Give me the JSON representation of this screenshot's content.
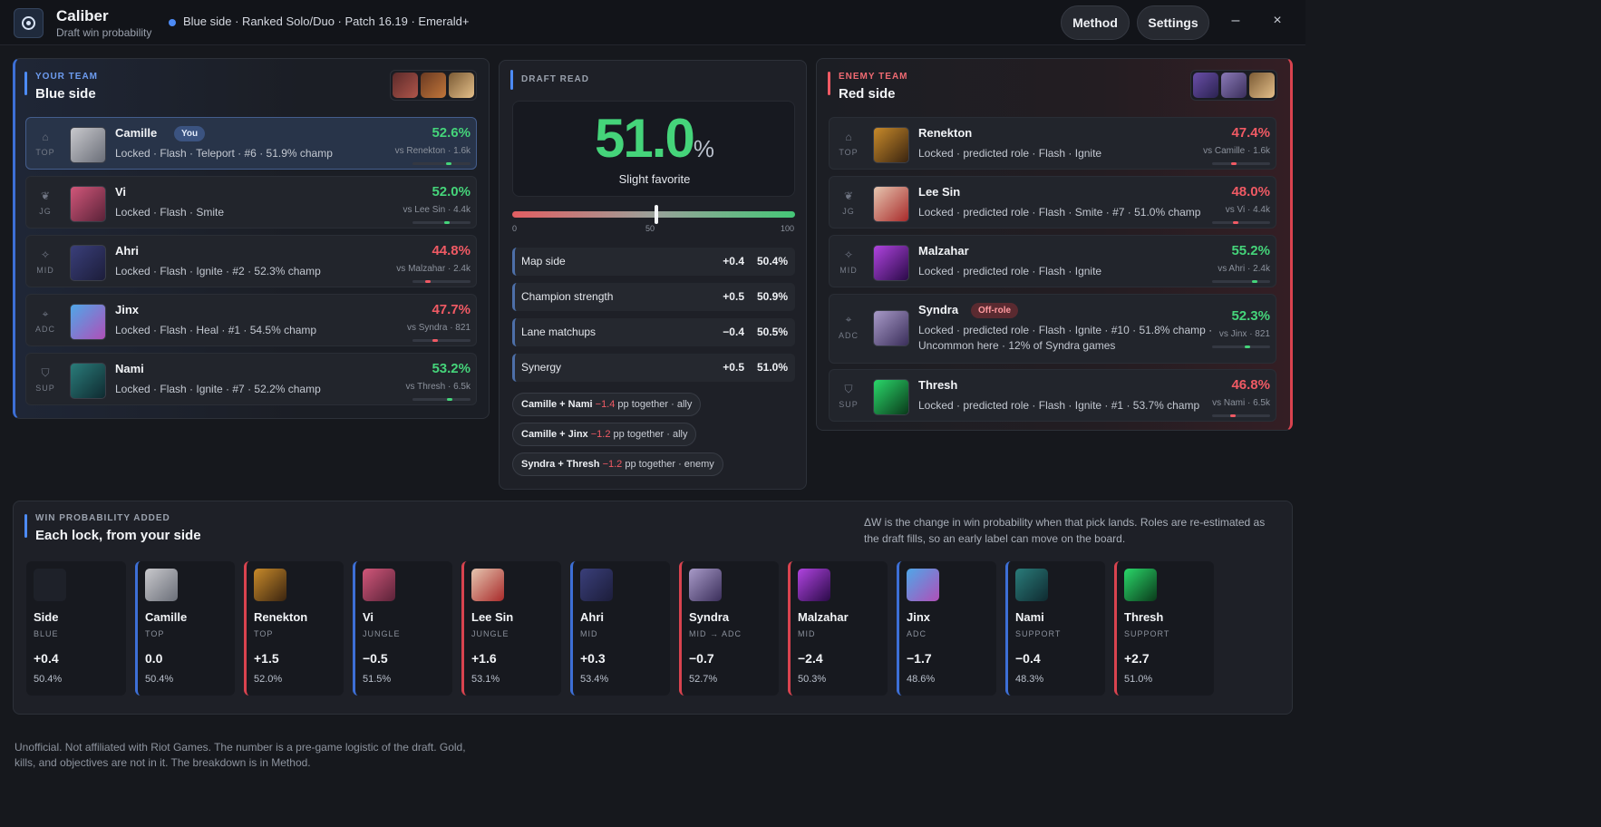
{
  "app": {
    "name": "Caliber",
    "subtitle": "Draft win probability",
    "context": "Blue side · Ranked Solo/Duo · Patch 16.19 · Emerald+",
    "method_label": "Method",
    "settings_label": "Settings",
    "minimize": "–",
    "close": "×"
  },
  "your_team": {
    "kicker": "YOUR TEAM",
    "title": "Blue side",
    "rows": [
      {
        "role": "TOP",
        "role_icon": "tower-icon",
        "name": "Camille",
        "badge": "You",
        "sub": "Locked · Flash · Teleport · #6 · 51.9% champ",
        "pct": "52.6%",
        "vs": "vs Renekton · 1.6k",
        "pct_value": 52.6
      },
      {
        "role": "JG",
        "role_icon": "leaf-icon",
        "name": "Vi",
        "sub": "Locked · Flash · Smite",
        "pct": "52.0%",
        "vs": "vs Lee Sin · 4.4k",
        "pct_value": 52.0
      },
      {
        "role": "MID",
        "role_icon": "star-icon",
        "name": "Ahri",
        "sub": "Locked · Flash · Ignite · #2 · 52.3% champ",
        "pct": "44.8%",
        "vs": "vs Malzahar · 2.4k",
        "pct_value": 44.8
      },
      {
        "role": "ADC",
        "role_icon": "crosshair-icon",
        "name": "Jinx",
        "sub": "Locked · Flash · Heal · #1 · 54.5% champ",
        "pct": "47.7%",
        "vs": "vs Syndra · 821",
        "pct_value": 47.7
      },
      {
        "role": "SUP",
        "role_icon": "shield-icon",
        "name": "Nami",
        "sub": "Locked · Flash · Ignite · #7 · 52.2% champ",
        "pct": "53.2%",
        "vs": "vs Thresh · 6.5k",
        "pct_value": 53.2
      }
    ]
  },
  "draft_read": {
    "kicker": "DRAFT READ",
    "win_number": "51.0",
    "win_unit": "%",
    "win_value": 51.0,
    "verdict": "Slight favorite",
    "scale": [
      "0",
      "50",
      "100"
    ],
    "factors": [
      {
        "label": "Map side",
        "delta": "+0.4",
        "value": "50.4%"
      },
      {
        "label": "Champion strength",
        "delta": "+0.5",
        "value": "50.9%"
      },
      {
        "label": "Lane matchups",
        "delta": "−0.4",
        "value": "50.5%"
      },
      {
        "label": "Synergy",
        "delta": "+0.5",
        "value": "51.0%"
      }
    ],
    "synergies": [
      {
        "pair": "Camille + Nami",
        "delta": "−1.4",
        "text": "pp together · ally"
      },
      {
        "pair": "Camille + Jinx",
        "delta": "−1.2",
        "text": "pp together · ally"
      },
      {
        "pair": "Syndra + Thresh",
        "delta": "−1.2",
        "text": "pp together · enemy"
      }
    ]
  },
  "enemy_team": {
    "kicker": "ENEMY TEAM",
    "title": "Red side",
    "rows": [
      {
        "role": "TOP",
        "role_icon": "tower-icon",
        "name": "Renekton",
        "sub": "Locked · predicted role · Flash · Ignite",
        "pct": "47.4%",
        "vs": "vs Camille · 1.6k",
        "pct_value": 47.4
      },
      {
        "role": "JG",
        "role_icon": "leaf-icon",
        "name": "Lee Sin",
        "sub": "Locked · predicted role · Flash · Smite · #7 · 51.0% champ",
        "pct": "48.0%",
        "vs": "vs Vi · 4.4k",
        "pct_value": 48.0
      },
      {
        "role": "MID",
        "role_icon": "star-icon",
        "name": "Malzahar",
        "sub": "Locked · predicted role · Flash · Ignite",
        "pct": "55.2%",
        "vs": "vs Ahri · 2.4k",
        "pct_value": 55.2
      },
      {
        "role": "ADC",
        "role_icon": "crosshair-icon",
        "name": "Syndra",
        "badge": "Off-role",
        "sub": "Locked · predicted role · Flash · Ignite · #10 · 51.8% champ ·",
        "sub2": "Uncommon here · 12% of Syndra games",
        "pct": "52.3%",
        "vs": "vs Jinx · 821",
        "pct_value": 52.3
      },
      {
        "role": "SUP",
        "role_icon": "shield-icon",
        "name": "Thresh",
        "sub": "Locked · predicted role · Flash · Ignite · #1 · 53.7% champ",
        "pct": "46.8%",
        "vs": "vs Nami · 6.5k",
        "pct_value": 46.8
      }
    ]
  },
  "timeline": {
    "kicker": "WIN PROBABILITY ADDED",
    "title": "Each lock, from your side",
    "note": "ΔW is the change in win probability when that pick lands. Roles are re-estimated as the draft fills, so an early label can move on the board.",
    "cards": [
      {
        "name": "Side",
        "role": "BLUE",
        "delta": "+0.4",
        "win": "50.4%",
        "team": "none"
      },
      {
        "name": "Camille",
        "role": "TOP",
        "delta": "0.0",
        "win": "50.4%",
        "team": "blue"
      },
      {
        "name": "Renekton",
        "role": "TOP",
        "delta": "+1.5",
        "win": "52.0%",
        "team": "red"
      },
      {
        "name": "Vi",
        "role": "JUNGLE",
        "delta": "−0.5",
        "win": "51.5%",
        "team": "blue"
      },
      {
        "name": "Lee Sin",
        "role": "JUNGLE",
        "delta": "+1.6",
        "win": "53.1%",
        "team": "red"
      },
      {
        "name": "Ahri",
        "role": "MID",
        "delta": "+0.3",
        "win": "53.4%",
        "team": "blue"
      },
      {
        "name": "Syndra",
        "role": "MID → ADC",
        "delta": "−0.7",
        "win": "52.7%",
        "team": "red"
      },
      {
        "name": "Malzahar",
        "role": "MID",
        "delta": "−2.4",
        "win": "50.3%",
        "team": "red"
      },
      {
        "name": "Jinx",
        "role": "ADC",
        "delta": "−1.7",
        "win": "48.6%",
        "team": "blue"
      },
      {
        "name": "Nami",
        "role": "SUPPORT",
        "delta": "−0.4",
        "win": "48.3%",
        "team": "blue"
      },
      {
        "name": "Thresh",
        "role": "SUPPORT",
        "delta": "+2.7",
        "win": "51.0%",
        "team": "red"
      }
    ]
  },
  "footer": "Unofficial. Not affiliated with Riot Games. The number is a pre-game logistic of the draft. Gold, kills, and objectives are not in it. The breakdown is in Method.",
  "colors": {
    "blue_accent": "#3d6fd6",
    "red_accent": "#d9434f",
    "positive": "#45d47a",
    "negative": "#f05a64"
  }
}
